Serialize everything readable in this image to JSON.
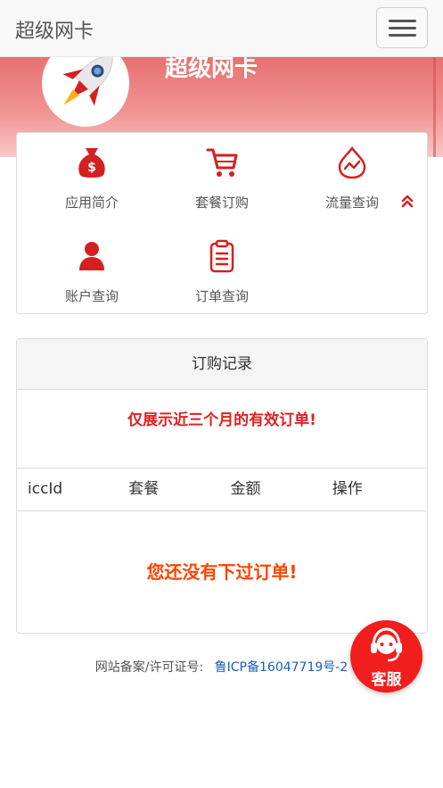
{
  "navbar": {
    "brand": "超级网卡",
    "menu_toggle_icon": "hamburger-icon"
  },
  "hero": {
    "title": "超级网卡",
    "logo_icon": "rocket-icon"
  },
  "menu": {
    "items": [
      {
        "label": "应用简介",
        "icon": "money-bag-icon"
      },
      {
        "label": "套餐订购",
        "icon": "shopping-cart-icon"
      },
      {
        "label": "流量查询",
        "icon": "water-drop-icon"
      },
      {
        "label": "账户查询",
        "icon": "user-icon"
      },
      {
        "label": "订单查询",
        "icon": "clipboard-icon"
      }
    ],
    "collapse_icon": "double-chevron-up-icon"
  },
  "orders": {
    "heading": "订购记录",
    "notice": "仅展示近三个月的有效订单!",
    "columns": [
      "iccId",
      "套餐",
      "金额",
      "操作"
    ],
    "empty_message": "您还没有下过订单!"
  },
  "footer": {
    "label": "网站备案/许可证号:",
    "icp": "鲁ICP备16047719号-2"
  },
  "support": {
    "label": "客服",
    "icon": "headset-icon"
  },
  "colors": {
    "accent": "#d42020",
    "hero": "#ec7f7f",
    "warning": "#ff4400"
  }
}
